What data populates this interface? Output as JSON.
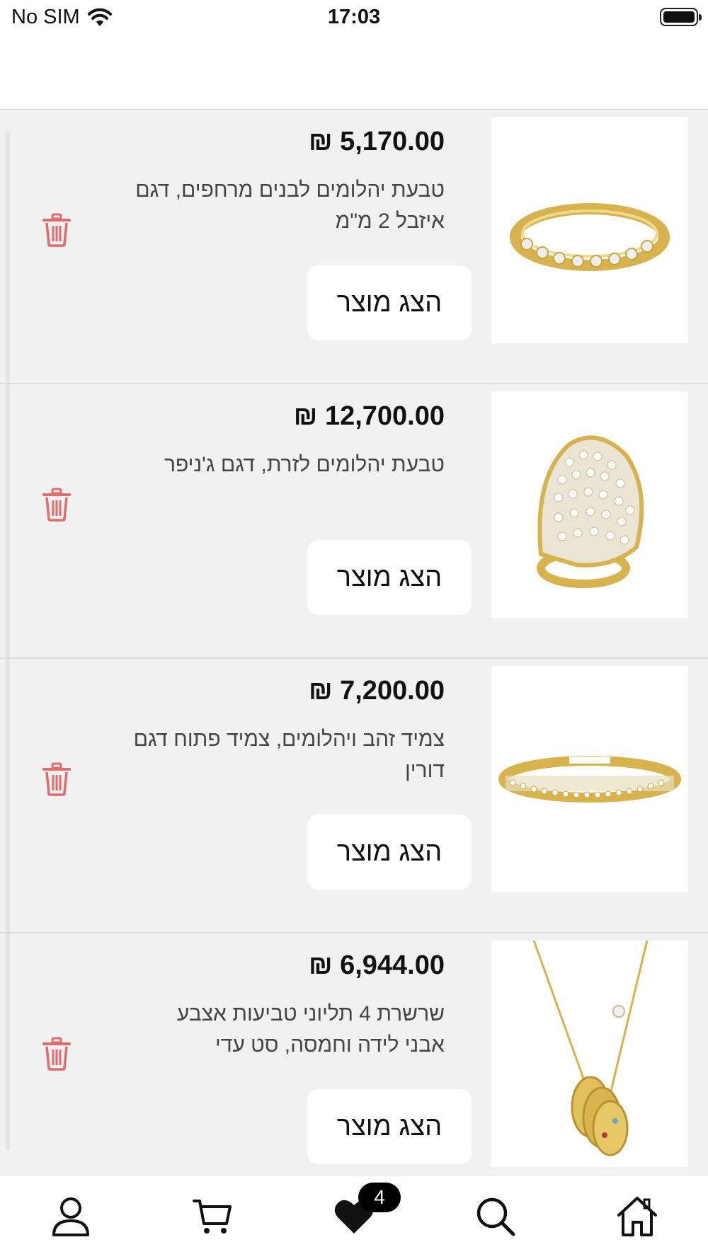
{
  "status_bar": {
    "carrier": "No SIM",
    "time": "17:03"
  },
  "items": [
    {
      "price": "₪ 5,170.00",
      "desc": "טבעת יהלומים לבנים מרחפים, דגם איזבל 2 מ\"מ",
      "button": "הצג מוצר",
      "image": "ring-eternity"
    },
    {
      "price": "₪ 12,700.00",
      "desc": "טבעת יהלומים לזרת, דגם ג'ניפר",
      "button": "הצג מוצר",
      "image": "ring-dome"
    },
    {
      "price": "₪ 7,200.00",
      "desc": "צמיד זהב ויהלומים, צמיד פתוח דגם דורין",
      "button": "הצג מוצר",
      "image": "bracelet-cuff"
    },
    {
      "price": "₪ 6,944.00",
      "desc": "שרשרת 4 תליוני טביעות אצבע אבני לידה וחמסה, סט עדי",
      "button": "הצג מוצר",
      "image": "necklace-pendants"
    }
  ],
  "tabbar": {
    "wishlist_count": "4",
    "icons": [
      "person-icon",
      "cart-icon",
      "heart-icon",
      "search-icon",
      "home-icon"
    ]
  },
  "colors": {
    "trash": "#e36b6b",
    "background": "#f1f1f1",
    "badge": "#000000"
  }
}
